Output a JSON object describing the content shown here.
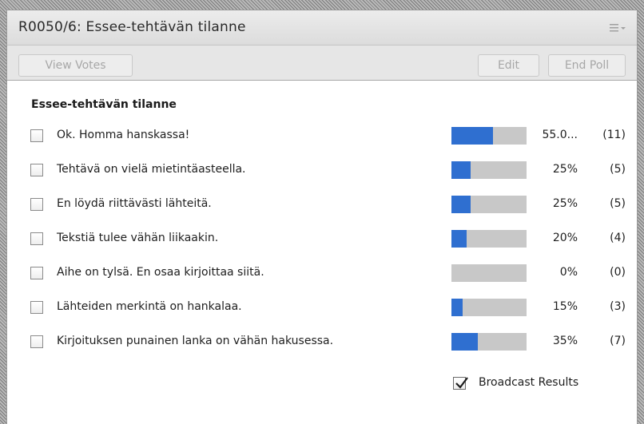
{
  "panel": {
    "title": "R0050/6: Essee-tehtävän tilanne",
    "menu_icon": "hamburger-dropdown-icon"
  },
  "toolbar": {
    "view_votes_label": "View Votes",
    "edit_label": "Edit",
    "end_poll_label": "End Poll"
  },
  "poll": {
    "question": "Essee-tehtävän tilanne",
    "bar_color": "#2f6fd0",
    "bar_bg_color": "#c8c8c8",
    "options": [
      {
        "label": "Ok. Homma hanskassa!",
        "percent_text": "55.0...",
        "count_text": "(11)",
        "fraction": 0.55
      },
      {
        "label": "Tehtävä on vielä mietintäasteella.",
        "percent_text": "25%",
        "count_text": "(5)",
        "fraction": 0.25
      },
      {
        "label": "En löydä riittävästi lähteitä.",
        "percent_text": "25%",
        "count_text": "(5)",
        "fraction": 0.25
      },
      {
        "label": "Tekstiä tulee vähän liikaakin.",
        "percent_text": "20%",
        "count_text": "(4)",
        "fraction": 0.2
      },
      {
        "label": "Aihe on tylsä. En osaa kirjoittaa siitä.",
        "percent_text": "0%",
        "count_text": "(0)",
        "fraction": 0.0
      },
      {
        "label": "Lähteiden merkintä on hankalaa.",
        "percent_text": "15%",
        "count_text": "(3)",
        "fraction": 0.15
      },
      {
        "label": "Kirjoituksen punainen lanka on vähän hakusessa.",
        "percent_text": "35%",
        "count_text": "(7)",
        "fraction": 0.35
      }
    ]
  },
  "broadcast": {
    "label": "Broadcast Results",
    "checked": true
  }
}
